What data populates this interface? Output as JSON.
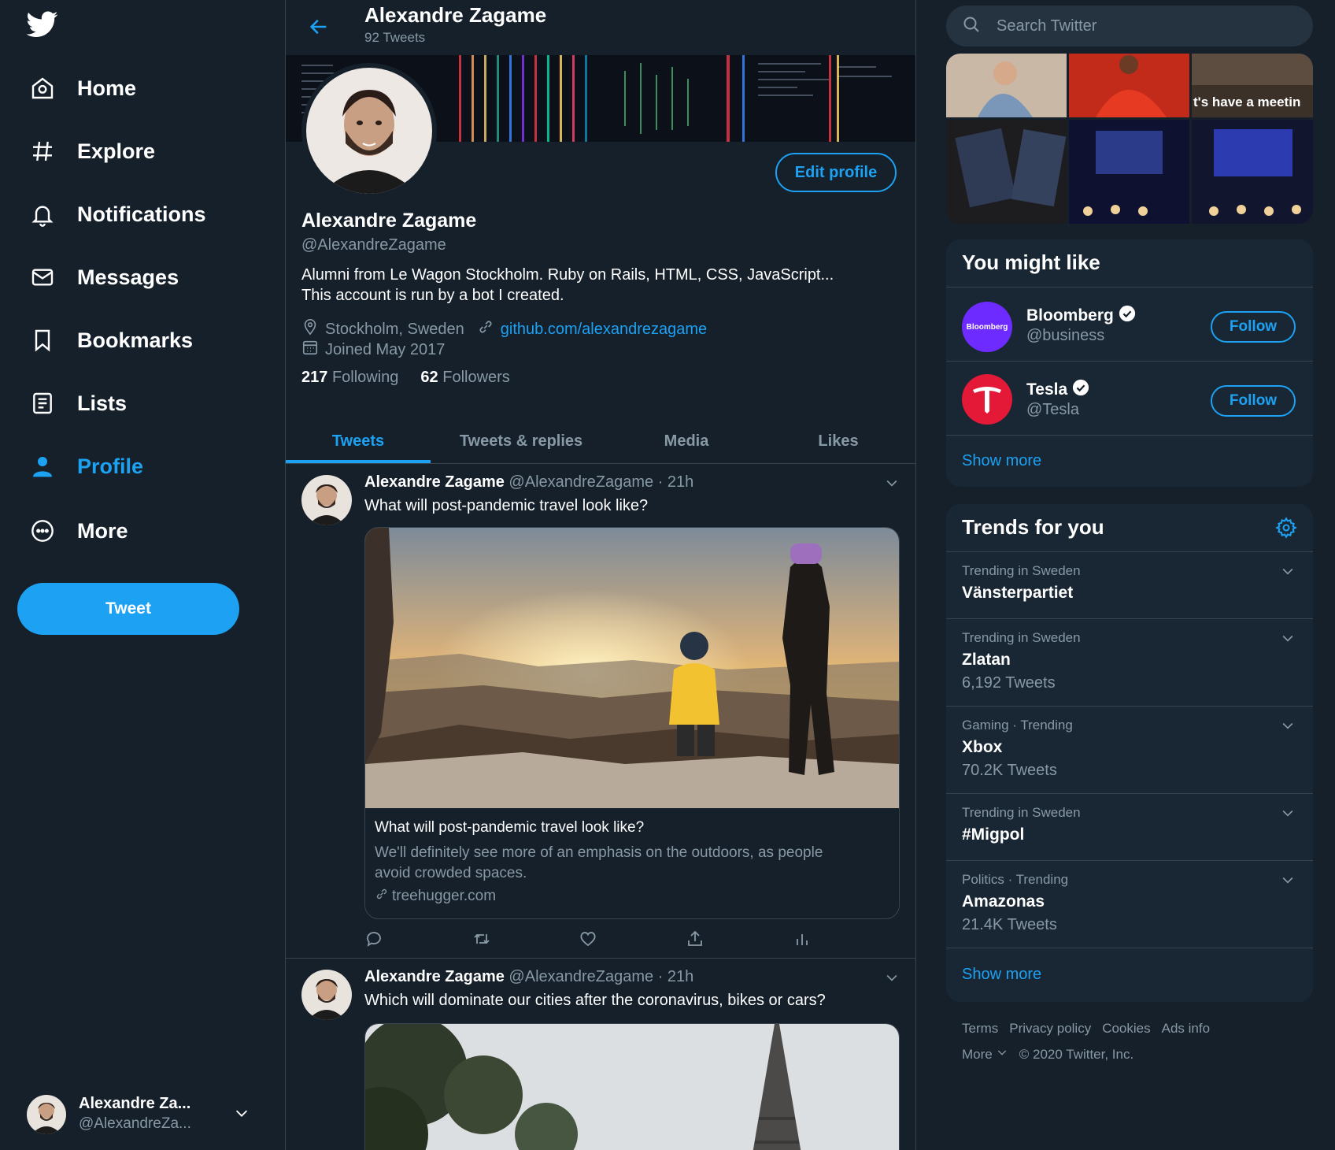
{
  "nav": {
    "items": [
      {
        "label": "Home",
        "icon": "home-icon"
      },
      {
        "label": "Explore",
        "icon": "hashtag-icon"
      },
      {
        "label": "Notifications",
        "icon": "bell-icon"
      },
      {
        "label": "Messages",
        "icon": "envelope-icon"
      },
      {
        "label": "Bookmarks",
        "icon": "bookmark-icon"
      },
      {
        "label": "Lists",
        "icon": "list-icon"
      },
      {
        "label": "Profile",
        "icon": "person-icon"
      },
      {
        "label": "More",
        "icon": "more-circle-icon"
      }
    ],
    "tweet_button": "Tweet",
    "account": {
      "name": "Alexandre Za...",
      "handle": "@AlexandreZa..."
    }
  },
  "header": {
    "name": "Alexandre Zagame",
    "tweet_count": "92 Tweets"
  },
  "profile": {
    "edit_button": "Edit profile",
    "name": "Alexandre Zagame",
    "handle": "@AlexandreZagame",
    "bio_line1": "Alumni from Le Wagon Stockholm. Ruby on Rails, HTML, CSS, JavaScript...",
    "bio_line2": "This account is run by a bot I created.",
    "location": "Stockholm, Sweden",
    "website": "github.com/alexandrezagame",
    "joined": "Joined May 2017",
    "following_count": "217",
    "following_label": "Following",
    "followers_count": "62",
    "followers_label": "Followers"
  },
  "tabs": [
    {
      "label": "Tweets"
    },
    {
      "label": "Tweets & replies"
    },
    {
      "label": "Media"
    },
    {
      "label": "Likes"
    }
  ],
  "tweets": [
    {
      "name": "Alexandre Zagame",
      "handle": "@AlexandreZagame",
      "time": "· 21h",
      "text": "What will post-pandemic travel look like?",
      "card_title": "What will post-pandemic travel look like?",
      "card_desc": "We'll definitely see more of an emphasis on the outdoors, as people avoid crowded spaces.",
      "card_domain": "treehugger.com"
    },
    {
      "name": "Alexandre Zagame",
      "handle": "@AlexandreZagame",
      "time": "· 21h",
      "text": "Which will dominate our cities after the coronavirus, bikes or cars?"
    }
  ],
  "right": {
    "search_placeholder": "Search Twitter",
    "photo_caption": "t's have a meetin",
    "you_might_like": {
      "title": "You might like",
      "accounts": [
        {
          "name": "Bloomberg",
          "handle": "@business",
          "logo_text": "Bloomberg",
          "follow": "Follow"
        },
        {
          "name": "Tesla",
          "handle": "@Tesla",
          "follow": "Follow"
        }
      ],
      "show_more": "Show more"
    },
    "trends": {
      "title": "Trends for you",
      "items": [
        {
          "context": "Trending in Sweden",
          "name": "Vänsterpartiet",
          "count": ""
        },
        {
          "context": "Trending in Sweden",
          "name": "Zlatan",
          "count": "6,192 Tweets"
        },
        {
          "context": "Gaming · Trending",
          "name": "Xbox",
          "count": "70.2K Tweets"
        },
        {
          "context": "Trending in Sweden",
          "name": "#Migpol",
          "count": ""
        },
        {
          "context": "Politics · Trending",
          "name": "Amazonas",
          "count": "21.4K Tweets"
        }
      ],
      "show_more": "Show more"
    },
    "footer": {
      "links": [
        "Terms",
        "Privacy policy",
        "Cookies",
        "Ads info"
      ],
      "more": "More",
      "copyright": "© 2020 Twitter, Inc."
    }
  },
  "colors": {
    "background": "#15202b",
    "accent": "#1da1f2",
    "panel": "#192734",
    "muted": "#8899a6"
  }
}
